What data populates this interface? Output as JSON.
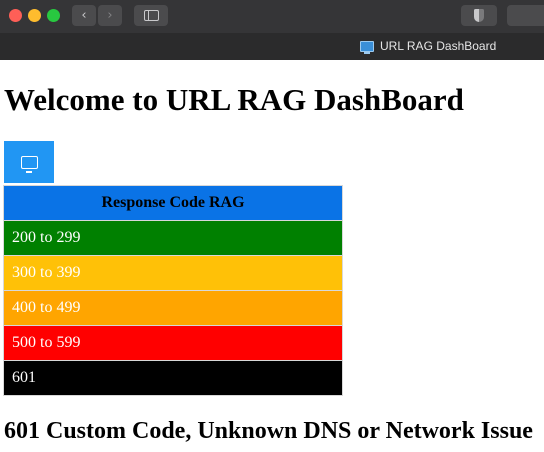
{
  "browser": {
    "tab_title": "URL RAG DashBoard",
    "nav_back_glyph": "‹",
    "nav_forward_glyph": "›",
    "icons": [
      "close-dot",
      "minimize-dot",
      "zoom-dot",
      "chevron-left-icon",
      "chevron-right-icon",
      "sidebar-icon",
      "shield-icon",
      "monitor-icon"
    ]
  },
  "page": {
    "title": "Welcome to URL RAG DashBoard",
    "table": {
      "header": "Response Code RAG",
      "rows": [
        {
          "label": "200 to 299",
          "color": "#008000"
        },
        {
          "label": "300 to 399",
          "color": "#ffc107"
        },
        {
          "label": "400 to 499",
          "color": "#ffa500"
        },
        {
          "label": "500 to 599",
          "color": "#ff0000"
        },
        {
          "label": "601",
          "color": "#000000"
        }
      ]
    },
    "footer_heading": "601 Custom Code, Unknown DNS or Network Issue",
    "accent_color": "#2196f3",
    "header_color": "#0a73e6"
  }
}
